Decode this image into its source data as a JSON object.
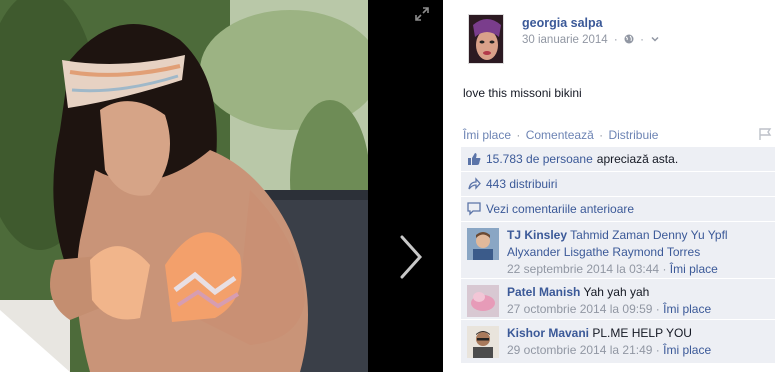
{
  "post": {
    "author": "georgia salpa",
    "date": "30 ianuarie 2014",
    "separator": "·",
    "text": "love this missoni bikini"
  },
  "actions": {
    "like": "Îmi place",
    "comment": "Comentează",
    "share": "Distribuie",
    "dot": "·"
  },
  "feedback": {
    "likes_count": "15.783 de persoane",
    "likes_suffix": "apreciază asta.",
    "shares": "443 distribuiri",
    "view_previous": "Vezi comentariile anterioare"
  },
  "comments": [
    {
      "name": "TJ Kinsley",
      "tags": "Tahmid Zaman Denny Yu Ypfl Alyxander Lisgathe Raymond Torres",
      "text": "",
      "time": "22 septembrie 2014 la 03:44",
      "like": "Îmi place"
    },
    {
      "name": "Patel Manish",
      "tags": "",
      "text": "Yah yah yah",
      "time": "27 octombrie 2014 la 09:59",
      "like": "Îmi place"
    },
    {
      "name": "Kishor Mavani",
      "tags": "",
      "text": "PL.ME HELP YOU",
      "time": "29 octombrie 2014 la 21:49",
      "like": "Îmi place"
    }
  ],
  "colors": {
    "link": "#3b5998",
    "feedback_bg": "#edeff4",
    "muted": "#9197a3",
    "viewer_bg": "#000000"
  },
  "icons": [
    "expand-icon",
    "chevron-right-icon",
    "globe-icon",
    "chevron-down-icon",
    "flag-icon",
    "thumbs-up-icon",
    "share-icon",
    "comment-icon"
  ]
}
